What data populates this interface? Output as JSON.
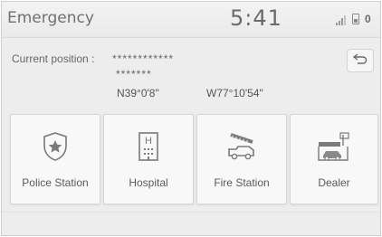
{
  "header": {
    "title": "Emergency",
    "time": "5:41",
    "status_count": "0",
    "icons": [
      "signal-icon",
      "battery-icon"
    ]
  },
  "position": {
    "label": "Current position",
    "separator": ":",
    "address_line1": "************",
    "address_line2": "*******",
    "latitude": "N39°0'8\"",
    "longitude": "W77°10'54\""
  },
  "back_icon": "back-arrow-icon",
  "tiles": [
    {
      "label": "Police Station",
      "icon": "police-badge-icon"
    },
    {
      "label": "Hospital",
      "icon": "hospital-icon"
    },
    {
      "label": "Fire Station",
      "icon": "fire-truck-icon"
    },
    {
      "label": "Dealer",
      "icon": "car-dealer-icon"
    }
  ]
}
